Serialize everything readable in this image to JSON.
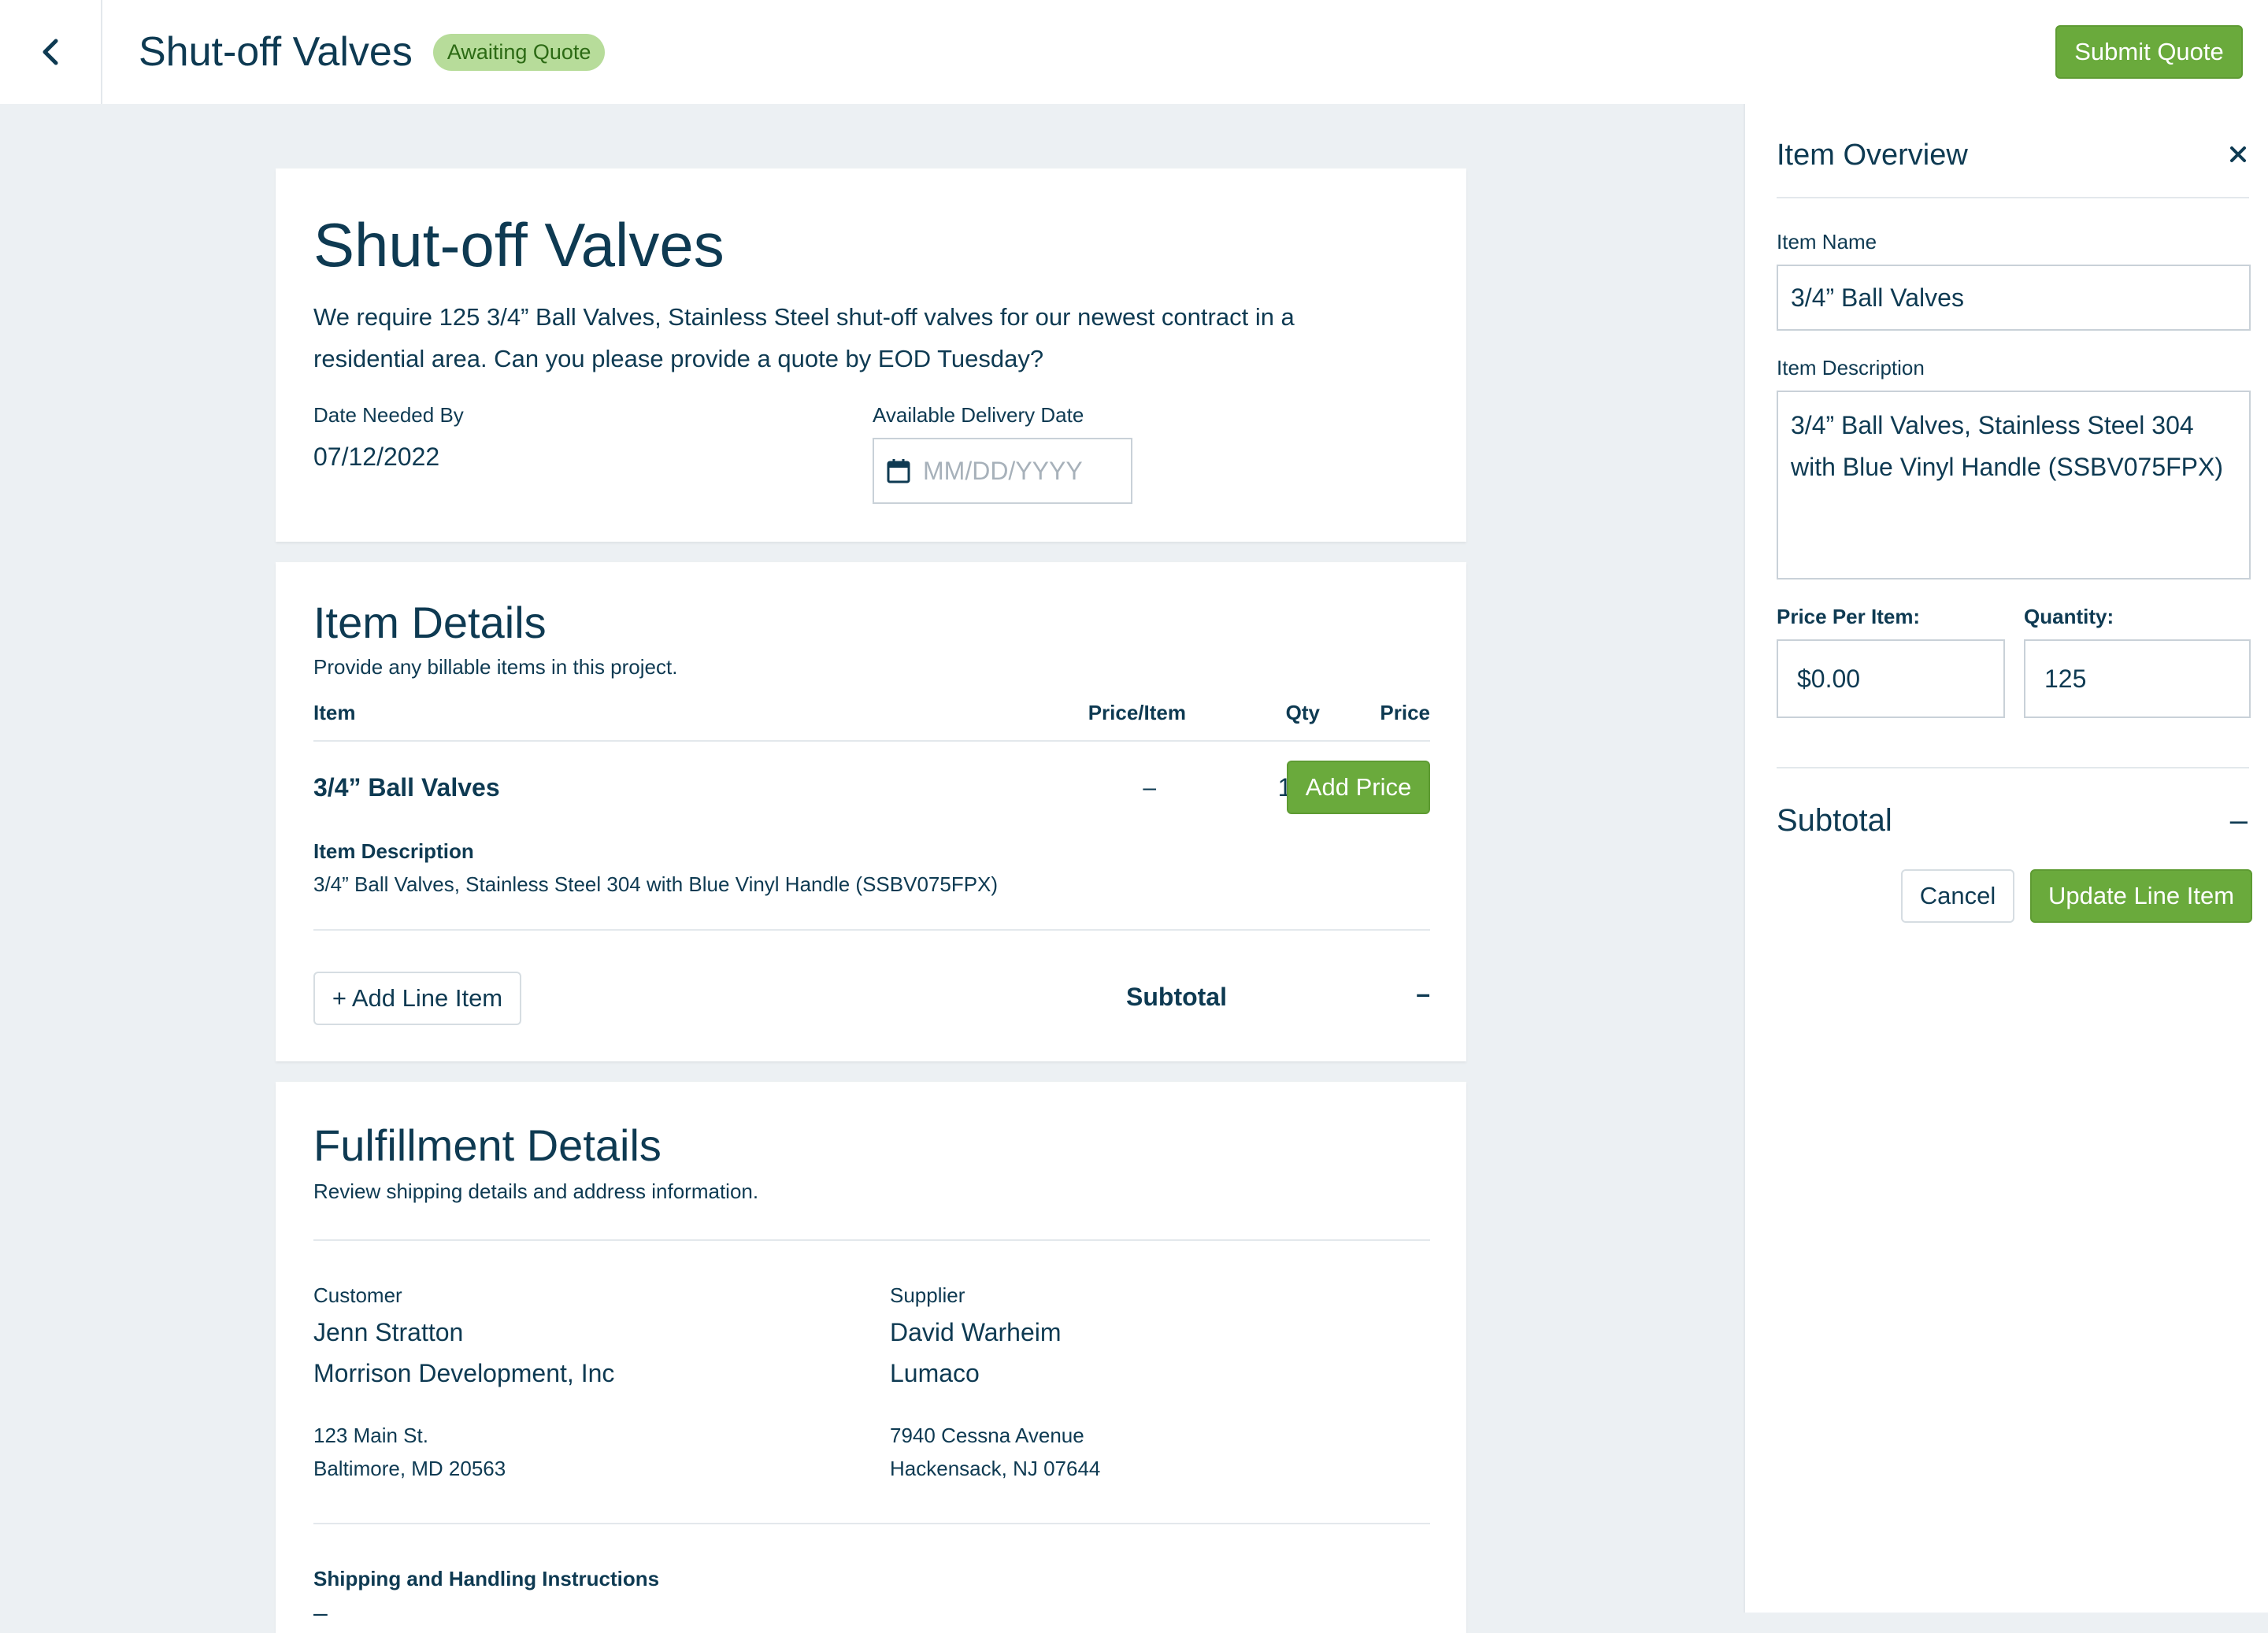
{
  "header": {
    "title": "Shut-off Valves",
    "status": "Awaiting Quote",
    "submit_label": "Submit Quote"
  },
  "request": {
    "title": "Shut-off Valves",
    "description": "We require 125 3/4” Ball Valves,  Stainless Steel shut-off valves for our newest contract in a residential area. Can you please provide a quote by EOD Tuesday?",
    "date_needed_label": "Date Needed By",
    "date_needed_value": "07/12/2022",
    "delivery_label": "Available Delivery Date",
    "delivery_placeholder": "MM/DD/YYYY"
  },
  "item_details": {
    "title": "Item Details",
    "subtitle": "Provide any billable items in this project.",
    "columns": [
      "Item",
      "Price/Item",
      "Qty",
      "Price"
    ],
    "rows": [
      {
        "name": "3/4” Ball Valves",
        "price_per_item": "–",
        "qty": "125",
        "action_label": "Add Price",
        "desc_label": "Item Description",
        "description": "3/4” Ball Valves, Stainless Steel 304 with Blue Vinyl Handle (SSBV075FPX)"
      }
    ],
    "add_line_label": "+ Add Line Item",
    "subtotal_label": "Subtotal",
    "subtotal_value": "–"
  },
  "fulfillment": {
    "title": "Fulfillment Details",
    "subtitle": "Review shipping details and address information.",
    "customer": {
      "label": "Customer",
      "name": "Jenn Stratton",
      "company": "Morrison Development, Inc",
      "address1": "123 Main St.",
      "address2": "Baltimore, MD 20563"
    },
    "supplier": {
      "label": "Supplier",
      "name": "David Warheim",
      "company": "Lumaco",
      "address1": "7940 Cessna Avenue",
      "address2": "Hackensack, NJ 07644"
    },
    "shipping_label": "Shipping and Handling Instructions",
    "shipping_value": "–"
  },
  "panel": {
    "title": "Item Overview",
    "name_label": "Item Name",
    "name_value": "3/4” Ball Valves",
    "desc_label": "Item Description",
    "desc_value": "3/4” Ball Valves, Stainless Steel 304 with Blue Vinyl Handle (SSBV075FPX)",
    "price_label": "Price Per Item:",
    "price_value": "$0.00",
    "qty_label": "Quantity:",
    "qty_value": "125",
    "subtotal_label": "Subtotal",
    "subtotal_value": "–",
    "cancel_label": "Cancel",
    "update_label": "Update Line Item"
  },
  "colors": {
    "primary_text": "#0e3a52",
    "accent_green": "#6aaa3c",
    "badge_bg": "#b7dc9a",
    "page_bg": "#ecf0f3"
  },
  "icons": [
    "chevron-left-icon",
    "calendar-icon",
    "close-icon"
  ]
}
